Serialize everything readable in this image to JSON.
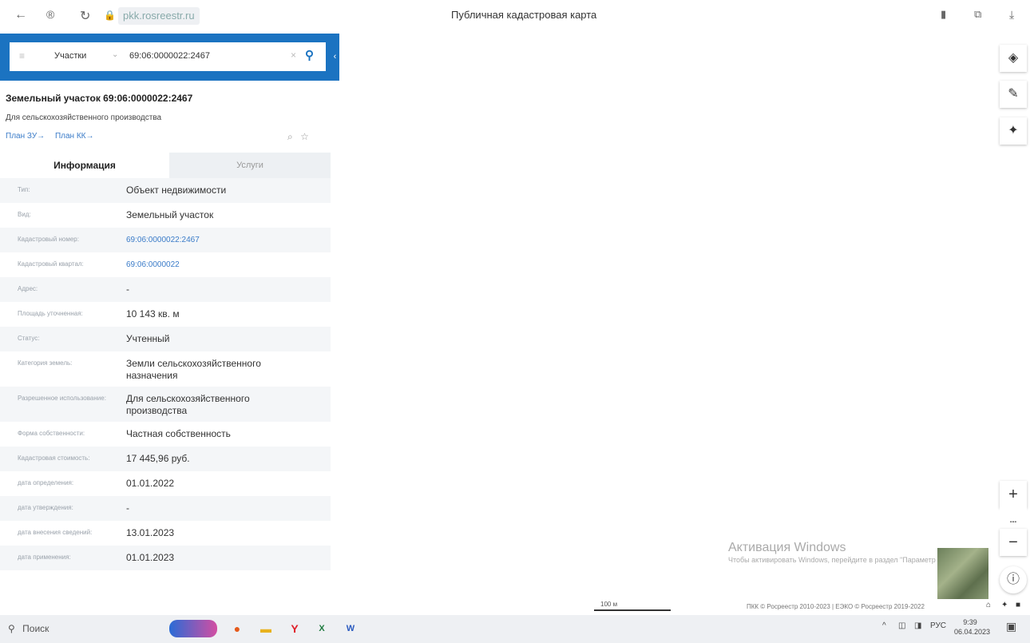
{
  "browser": {
    "url": "pkk.rosreestr.ru",
    "page_title": "Публичная кадастровая карта"
  },
  "search": {
    "category": "Участки",
    "query": "69:06:0000022:2467"
  },
  "object": {
    "title": "Земельный участок 69:06:0000022:2467",
    "subtitle": "Для сельскохозяйственного производства",
    "link_zu": "План ЗУ→",
    "link_kk": "План КК→"
  },
  "tabs": {
    "info": "Информация",
    "services": "Услуги"
  },
  "info_rows": [
    {
      "key": "Тип:",
      "value": "Объект недвижимости"
    },
    {
      "key": "Вид:",
      "value": "Земельный участок"
    },
    {
      "key": "Кадастровый номер:",
      "value": "69:06:0000022:2467"
    },
    {
      "key": "Кадастровый квартал:",
      "value": "69:06:0000022"
    },
    {
      "key": "Адрес:",
      "value": "-"
    },
    {
      "key": "Площадь уточненная:",
      "value": "10 143 кв. м"
    },
    {
      "key": "Статус:",
      "value": "Учтенный"
    },
    {
      "key": "Категория земель:",
      "value": "Земли сельскохозяйственного назначения"
    },
    {
      "key": "Разрешенное использование:",
      "value": "Для сельскохозяйственного производства"
    },
    {
      "key": "Форма собственности:",
      "value": "Частная собственность"
    },
    {
      "key": "Кадастровая стоимость:",
      "value": "17 445,96 руб."
    },
    {
      "key": "дата определения:",
      "value": "01.01.2022"
    },
    {
      "key": "дата утверждения:",
      "value": "-"
    },
    {
      "key": "дата внесения сведений:",
      "value": "13.01.2023"
    },
    {
      "key": "дата применения:",
      "value": "01.01.2023"
    }
  ],
  "map": {
    "scale_label": "100 м",
    "copyright": "ПКК © Росреестр 2010-2023 | ЕЭКО © Росреестр 2019-2022",
    "activation_title": "Активация Windows",
    "activation_text": "Чтобы активировать Windows, перейдите в раздел \"Параметры\"."
  },
  "taskbar": {
    "search_label": "Поиск",
    "lang": "РУС",
    "time": "9:39",
    "date": "06.04.2023"
  },
  "colors": {
    "accent": "#1b73c1",
    "link": "#3a7bc8"
  }
}
